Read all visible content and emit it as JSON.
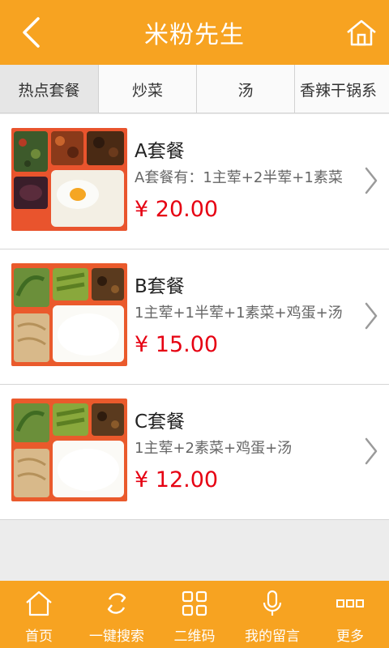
{
  "header": {
    "title": "米粉先生",
    "back_icon": "back-chevron-icon",
    "home_icon": "home-icon",
    "color": "#f7a321"
  },
  "tabs": [
    {
      "label": "热点套餐",
      "active": true
    },
    {
      "label": "炒菜",
      "active": false
    },
    {
      "label": "汤",
      "active": false
    },
    {
      "label": "香辣干锅系",
      "active": false
    }
  ],
  "items": [
    {
      "name": "A套餐",
      "desc": "A套餐有：1主荤+2半荤+1素菜",
      "price": "¥ 20.00"
    },
    {
      "name": "B套餐",
      "desc": "1主荤+1半荤+1素菜+鸡蛋+汤",
      "price": "¥ 15.00"
    },
    {
      "name": "C套餐",
      "desc": "1主荤+2素菜+鸡蛋+汤",
      "price": "¥ 12.00"
    }
  ],
  "footer": [
    {
      "label": "首页",
      "icon": "home-icon"
    },
    {
      "label": "一键搜索",
      "icon": "sync-icon"
    },
    {
      "label": "二维码",
      "icon": "grid-icon"
    },
    {
      "label": "我的留言",
      "icon": "microphone-icon"
    },
    {
      "label": "更多",
      "icon": "more-icon"
    }
  ],
  "colors": {
    "accent": "#f7a321",
    "price": "#e60012"
  }
}
